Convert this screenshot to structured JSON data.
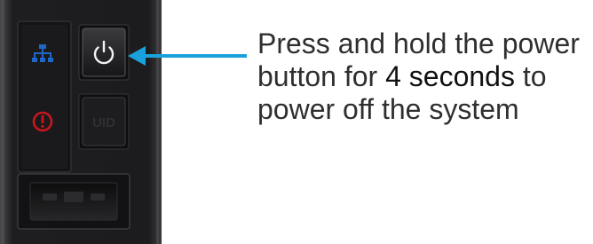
{
  "instruction": {
    "line1": "Press and hold the power",
    "line2_before": "button for ",
    "line2_emphasis": "4 seconds",
    "line2_after": " to",
    "line3": "power off the system"
  },
  "icons": {
    "network": "network-icon",
    "alert": "alert-icon",
    "power": "power-icon",
    "uid": "uid-icon",
    "arrow": "arrow-left-icon"
  },
  "uid_button": {
    "label": "UID"
  },
  "colors": {
    "panel": "#1d1d1f",
    "network_led": "#1f66c7",
    "alert_led": "#c8161d",
    "arrow": "#1aa1dc",
    "text": "#2f2f2f"
  }
}
